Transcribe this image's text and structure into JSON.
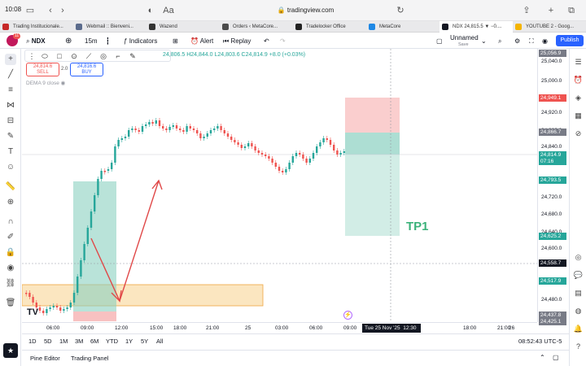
{
  "browser": {
    "time": "10:08",
    "url": "tradingview.com",
    "tabs": [
      {
        "label": "Trading Institucionale...",
        "color": "#c62828"
      },
      {
        "label": "Webmail :: Bienveni...",
        "color": "#5b6b8c"
      },
      {
        "label": "Wazend",
        "color": "#333333"
      },
      {
        "label": "Orders ‹ MetaCore...",
        "color": "#4a4a4a"
      },
      {
        "label": "Tradelocker Office",
        "color": "#222222"
      },
      {
        "label": "MetaCore",
        "color": "#1e88e5"
      },
      {
        "label": "NDX 24,815.5 ▼ −0....",
        "color": "#131722"
      },
      {
        "label": "YOUTUBE 2 - Goog...",
        "color": "#f4b400"
      }
    ]
  },
  "toolbar": {
    "symbol": "NDX",
    "interval": "15m",
    "indicators": "Indicators",
    "alert": "Alert",
    "replay": "Replay",
    "layout_name": "Unnamed",
    "layout_status": "Save",
    "publish": "Publish",
    "avatar_badge": "11"
  },
  "legend": {
    "ohlc": "24,806.5  H24,844.0  L24,803.6  C24,814.9  +8.0 (+0.03%)",
    "sell_price": "24,814.6",
    "sell_label": "SELL",
    "spread": "2.0",
    "buy_price": "24,816.6",
    "buy_label": "BUY",
    "indicator": "DEMA 9 close"
  },
  "price_axis": {
    "labels": [
      "25,040.0",
      "25,000.0",
      "24,960.0",
      "24,920.0",
      "24,880.0",
      "24,840.0",
      "24,760.0",
      "24,720.0",
      "24,680.0",
      "24,640.0",
      "24,600.0",
      "24,480.0"
    ],
    "tags": [
      {
        "text": "25,056.9",
        "color": "#787b86"
      },
      {
        "text": "24,949.1",
        "color": "#ef5350"
      },
      {
        "text": "24,866.7",
        "color": "#787b86"
      },
      {
        "text": "24,814.9",
        "color": "#26a69a"
      },
      {
        "text": "07:16",
        "color": "#26a69a"
      },
      {
        "text": "24,793.5",
        "color": "#26a69a"
      },
      {
        "text": "24,625.2",
        "color": "#26a69a"
      },
      {
        "text": "24,558.7",
        "color": "#131722"
      },
      {
        "text": "24,517.9",
        "color": "#26a69a"
      },
      {
        "text": "24,437.8",
        "color": "#787b86"
      },
      {
        "text": "24,425.1",
        "color": "#787b86"
      }
    ]
  },
  "time_axis": {
    "labels": [
      "06:00",
      "09:00",
      "12:00",
      "15:00",
      "18:00",
      "21:00",
      "25",
      "03:00",
      "06:00",
      "09:00",
      "15:00",
      "18:00",
      "21:00",
      "26"
    ],
    "crosshair_label": "Tue 25 Nov '25",
    "crosshair_time": "12:30"
  },
  "annotation": {
    "tp": "TP1"
  },
  "ranges": [
    "1D",
    "5D",
    "1M",
    "3M",
    "6M",
    "YTD",
    "1Y",
    "5Y",
    "All"
  ],
  "clock": "08:52:43 UTC-5",
  "panels": {
    "pine": "Pine Editor",
    "trading": "Trading Panel"
  },
  "colors": {
    "up": "#26a69a",
    "down": "#ef5350",
    "accent": "#2962ff"
  }
}
